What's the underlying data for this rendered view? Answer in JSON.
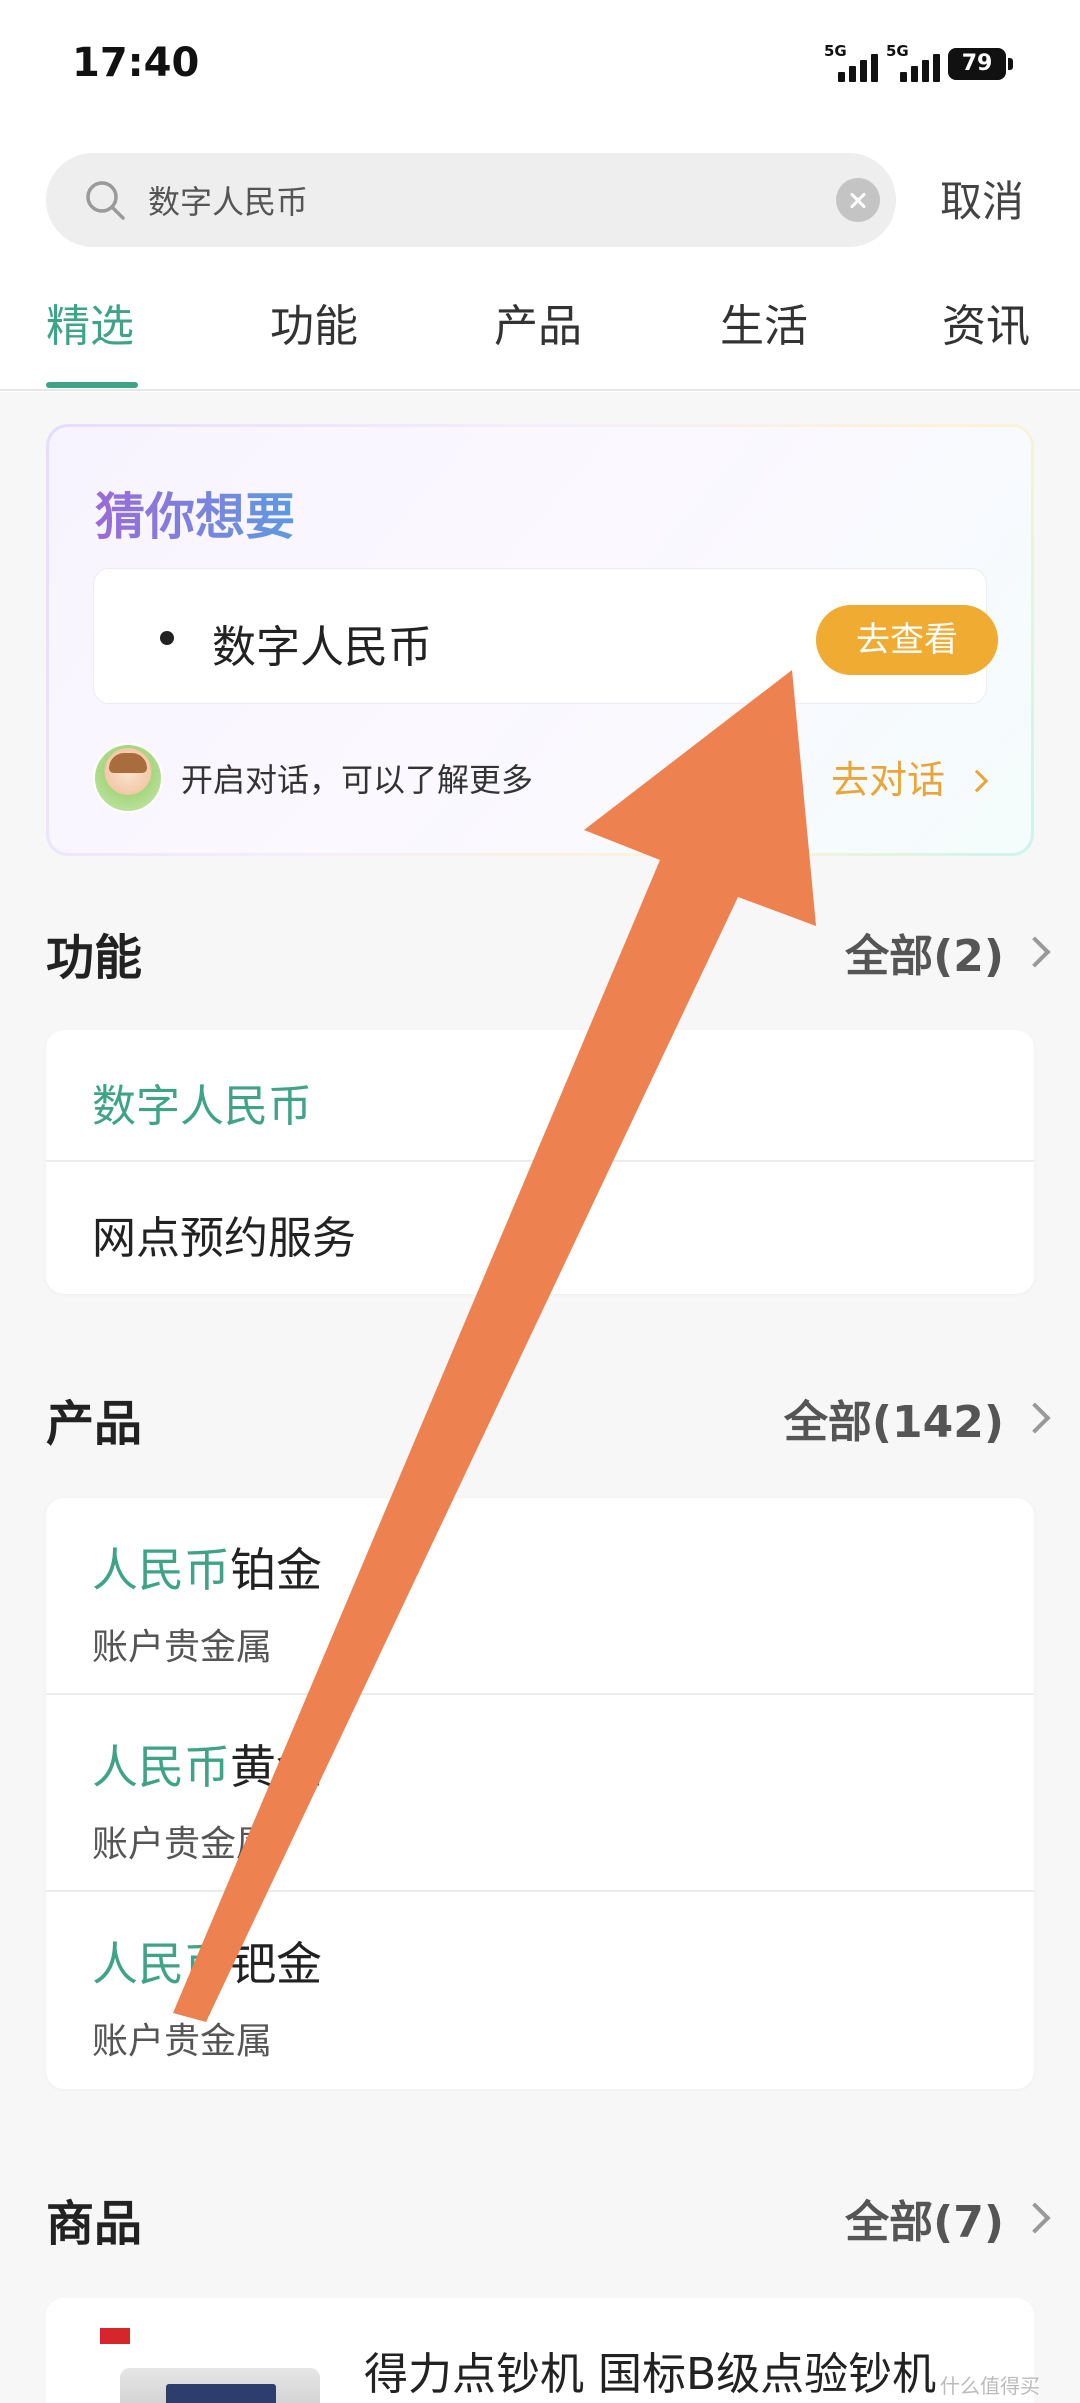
{
  "status_bar": {
    "time": "17:40",
    "signal1": "5G",
    "signal2": "5G",
    "battery": "79"
  },
  "search": {
    "query": "数字人民币",
    "cancel_label": "取消"
  },
  "tabs": [
    {
      "label": "精选",
      "active": true
    },
    {
      "label": "功能",
      "active": false
    },
    {
      "label": "产品",
      "active": false
    },
    {
      "label": "生活",
      "active": false
    },
    {
      "label": "资讯",
      "active": false
    }
  ],
  "guess": {
    "title": "猜你想要",
    "suggestion": "数字人民币",
    "view_button": "去查看",
    "chat_hint": "开启对话，可以了解更多",
    "chat_link": "去对话"
  },
  "functions": {
    "title": "功能",
    "more": "全部(2)",
    "items": [
      {
        "label": "数字人民币"
      },
      {
        "label": "网点预约服务"
      }
    ]
  },
  "products": {
    "title": "产品",
    "more": "全部(142)",
    "items": [
      {
        "highlight": "人民币",
        "suffix": "铂金",
        "sub": "账户贵金属"
      },
      {
        "highlight": "人民币",
        "suffix": "黄金",
        "sub": "账户贵金属"
      },
      {
        "highlight": "人民币",
        "suffix": "钯金",
        "sub": "账户贵金属"
      }
    ]
  },
  "goods": {
    "title": "商品",
    "more": "全部(7)",
    "items": [
      {
        "title": "得力点钞机 国标B级点验钞机"
      }
    ]
  },
  "watermark": "什么值得买",
  "colors": {
    "accent": "#3fa487",
    "orange": "#f0ab32",
    "annotation_arrow": "#ed8150"
  }
}
